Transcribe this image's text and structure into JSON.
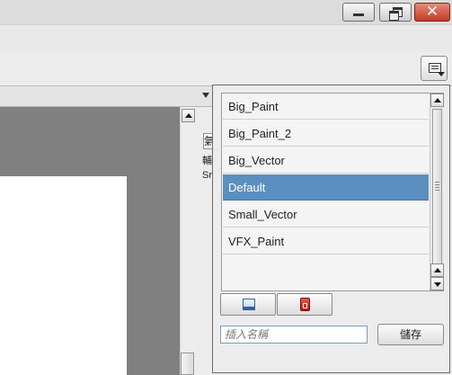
{
  "window": {
    "minimize_icon": "minimize-icon",
    "restore_icon": "restore-icon",
    "close_icon": "close-icon",
    "close_glyph": "✕"
  },
  "toolbar": {
    "menu_button_icon": "document-menu-icon"
  },
  "side_panel": {
    "field_text": "氣",
    "text_line1": "輔",
    "text_line2": "Sr"
  },
  "workspace_popup": {
    "items": [
      {
        "label": "Big_Paint",
        "selected": false
      },
      {
        "label": "Big_Paint_2",
        "selected": false
      },
      {
        "label": "Big_Vector",
        "selected": false
      },
      {
        "label": "Default",
        "selected": true
      },
      {
        "label": "Small_Vector",
        "selected": false
      },
      {
        "label": "VFX_Paint",
        "selected": false
      }
    ],
    "new_icon": "new-workspace-icon",
    "delete_icon": "delete-workspace-icon",
    "name_input_placeholder": "插入名稱",
    "save_label": "儲存"
  },
  "colors": {
    "selection": "#5b8fbf",
    "close_button": "#c33b24",
    "canvas_bg": "#808080"
  }
}
